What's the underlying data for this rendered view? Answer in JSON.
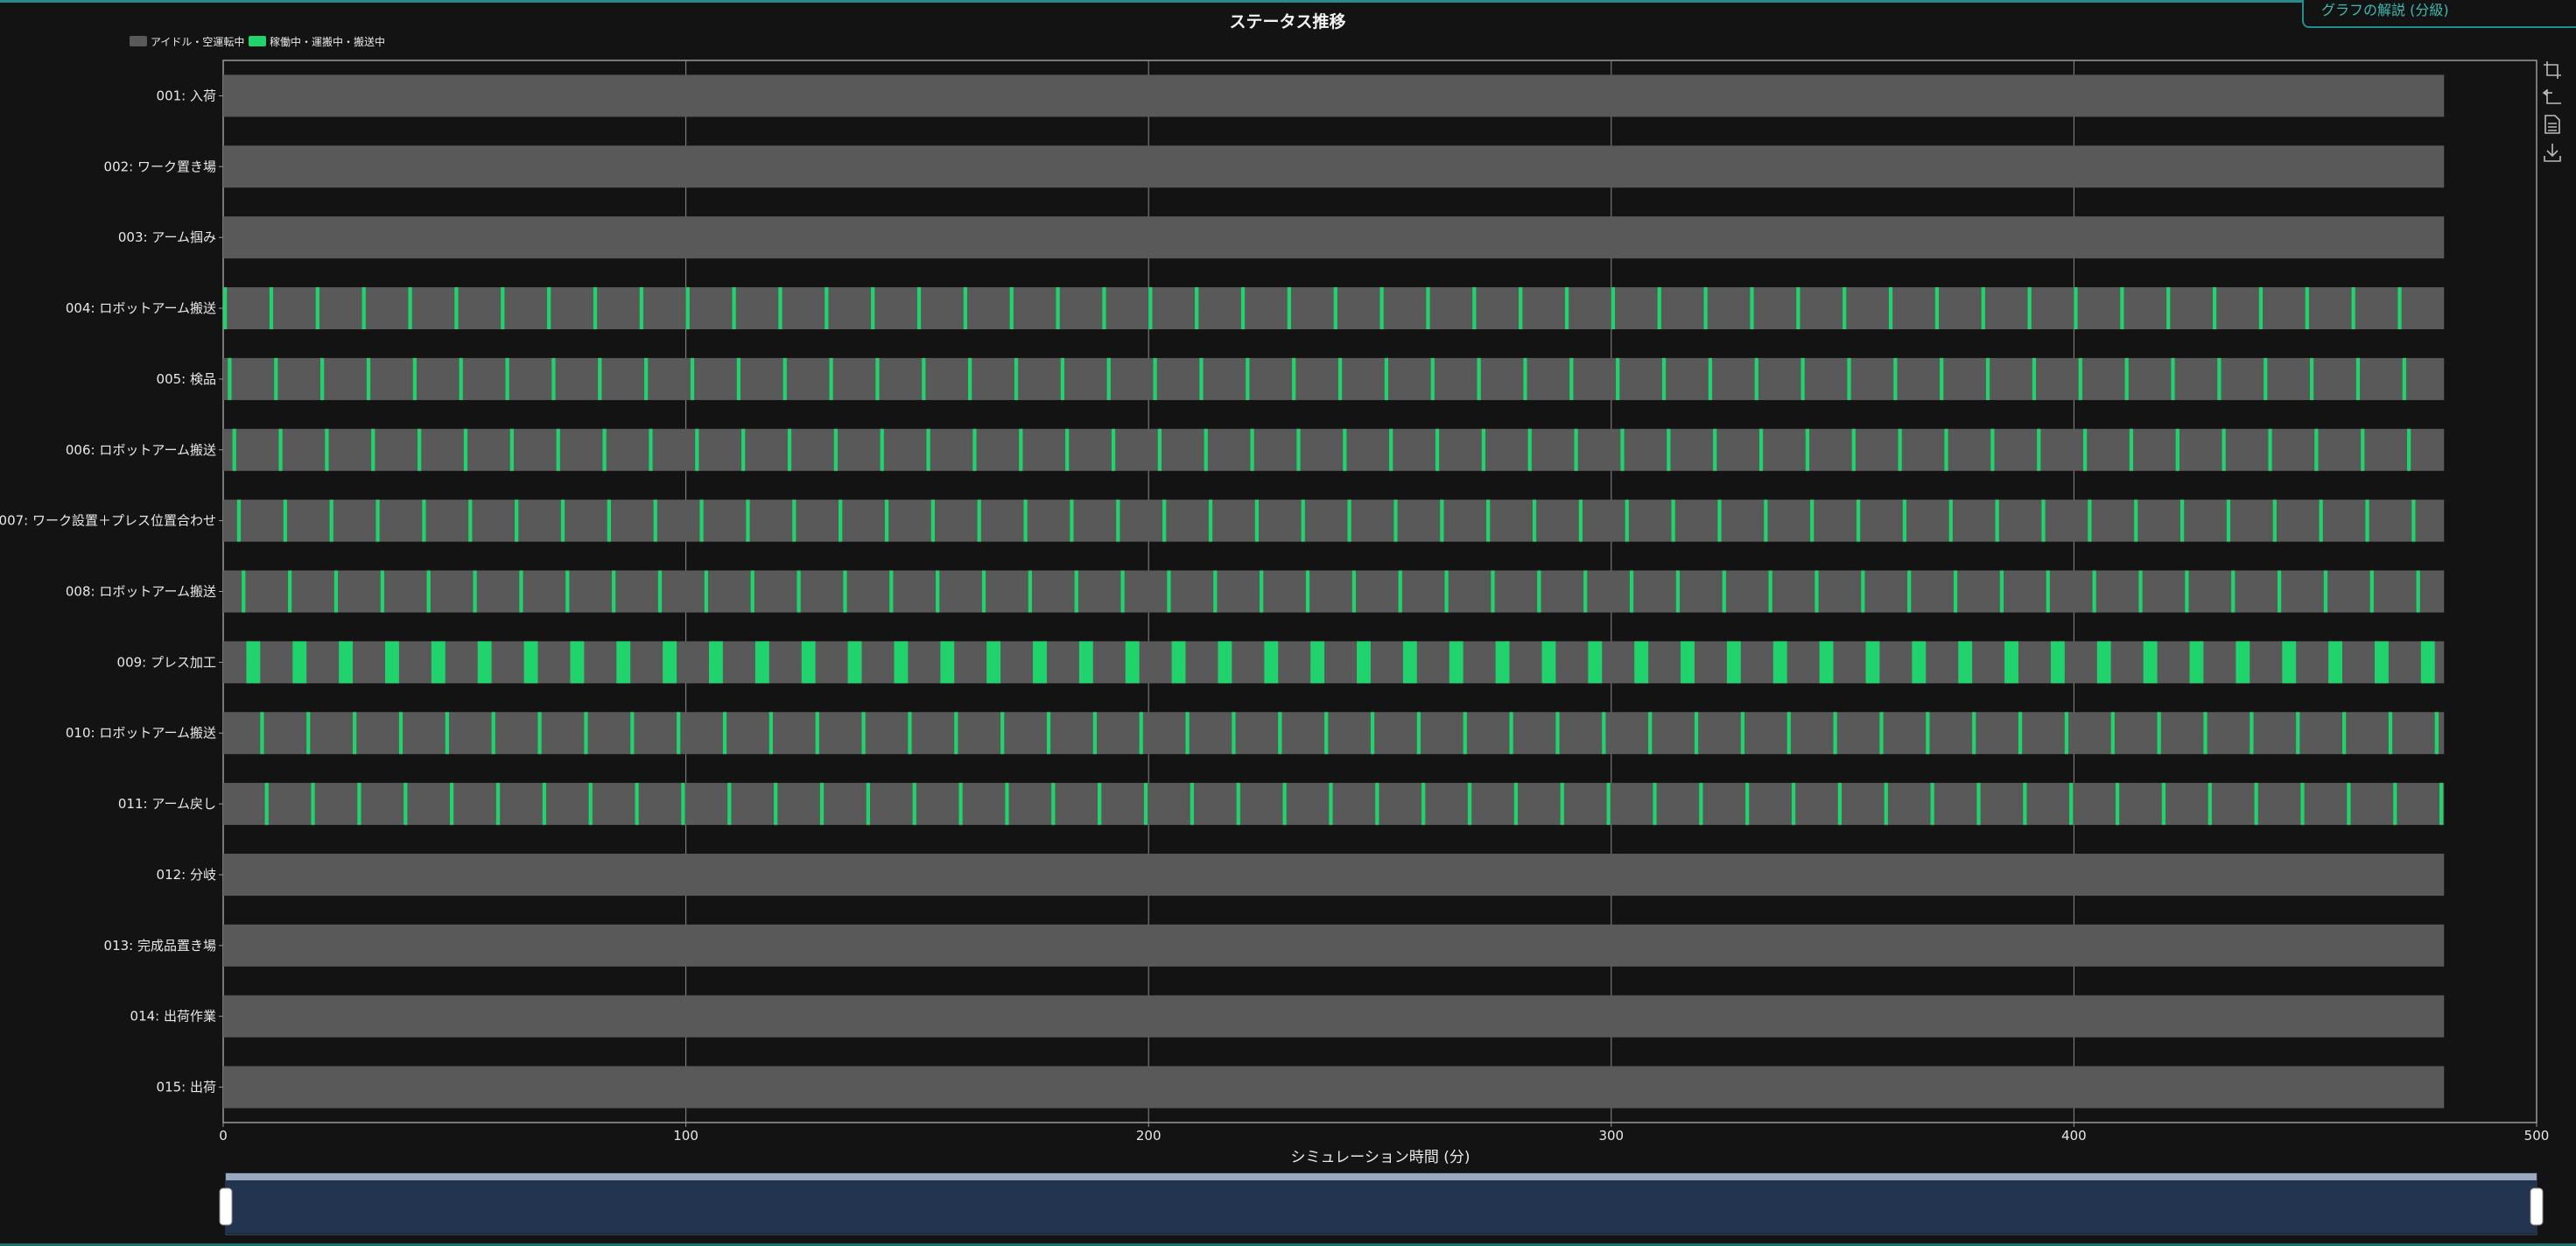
{
  "panel": {
    "help_label": "グラフの解説 (分級)"
  },
  "toolbar": [
    {
      "name": "zoom-icon"
    },
    {
      "name": "zoom-reset-icon"
    },
    {
      "name": "data-view-icon"
    },
    {
      "name": "download-icon"
    }
  ],
  "colors": {
    "idle": "#595959",
    "active": "#21d36c",
    "grid": "#8a8a8a",
    "slider": "#22344f"
  },
  "chart_data": {
    "type": "gantt",
    "title": "ステータス推移",
    "xlabel": "シミュレーション時間 (分)",
    "xlim": [
      0,
      500
    ],
    "xticks": [
      0,
      100,
      200,
      300,
      400,
      500
    ],
    "grid": true,
    "legend_position": "top-left",
    "legend": [
      {
        "label": "アイドル・空運転中",
        "color": "#595959"
      },
      {
        "label": "稼働中・運搬中・搬送中",
        "color": "#21d36c"
      }
    ],
    "rows": [
      {
        "label": "001: 入荷",
        "span": [
          0,
          480
        ],
        "active": null
      },
      {
        "label": "002: ワーク置き場",
        "span": [
          0,
          480
        ],
        "active": null
      },
      {
        "label": "003: アーム掴み",
        "span": [
          0,
          480
        ],
        "active": null
      },
      {
        "label": "004: ロボットアーム搬送",
        "span": [
          0,
          480
        ],
        "active": {
          "start": 0,
          "period": 10,
          "duration": 0.8,
          "count": 48
        }
      },
      {
        "label": "005: 検品",
        "span": [
          0,
          480
        ],
        "active": {
          "start": 1,
          "period": 10,
          "duration": 0.8,
          "count": 48
        }
      },
      {
        "label": "006: ロボットアーム搬送",
        "span": [
          0,
          480
        ],
        "active": {
          "start": 2,
          "period": 10,
          "duration": 0.8,
          "count": 48
        }
      },
      {
        "label": "007: ワーク設置＋プレス位置合わせ",
        "span": [
          0,
          480
        ],
        "active": {
          "start": 3,
          "period": 10,
          "duration": 0.8,
          "count": 48
        }
      },
      {
        "label": "008: ロボットアーム搬送",
        "span": [
          0,
          480
        ],
        "active": {
          "start": 4,
          "period": 10,
          "duration": 0.8,
          "count": 48
        }
      },
      {
        "label": "009: プレス加工",
        "span": [
          0,
          480
        ],
        "active": {
          "start": 5,
          "period": 10,
          "duration": 3,
          "count": 48
        }
      },
      {
        "label": "010: ロボットアーム搬送",
        "span": [
          0,
          480
        ],
        "active": {
          "start": 8,
          "period": 10,
          "duration": 0.8,
          "count": 48
        }
      },
      {
        "label": "011: アーム戻し",
        "span": [
          0,
          480
        ],
        "active": {
          "start": 9,
          "period": 10,
          "duration": 0.8,
          "count": 48
        }
      },
      {
        "label": "012: 分岐",
        "span": [
          0,
          480
        ],
        "active": null
      },
      {
        "label": "013: 完成品置き場",
        "span": [
          0,
          480
        ],
        "active": null
      },
      {
        "label": "014: 出荷作業",
        "span": [
          0,
          480
        ],
        "active": null
      },
      {
        "label": "015: 出荷",
        "span": [
          0,
          480
        ],
        "active": null
      }
    ],
    "zoom_range": [
      0,
      500
    ]
  }
}
